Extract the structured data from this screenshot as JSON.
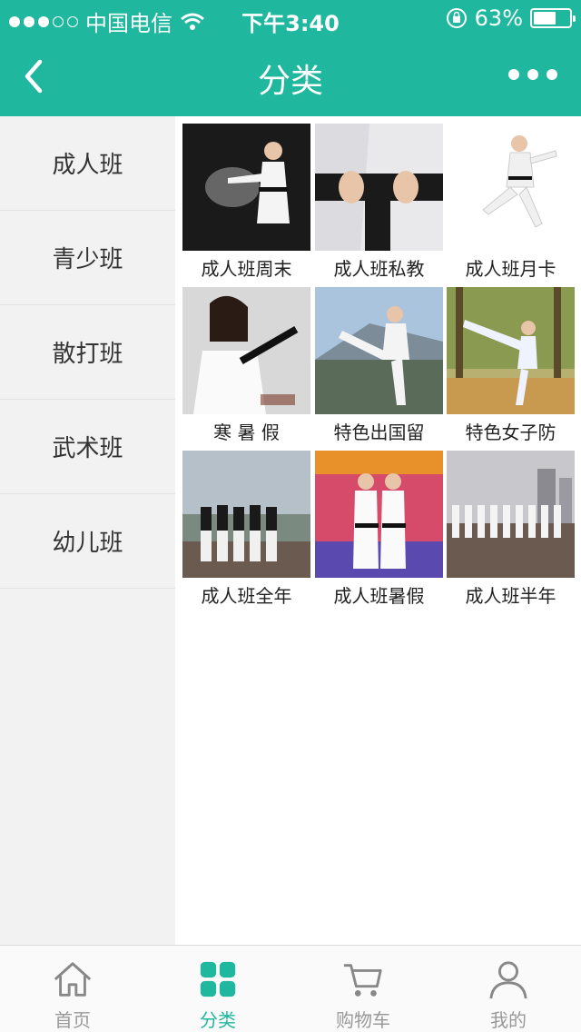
{
  "status": {
    "carrier": "中国电信",
    "time": "下午3:40",
    "battery": "63%",
    "battery_level": 0.63
  },
  "nav": {
    "title": "分类"
  },
  "colors": {
    "accent": "#1fb89f"
  },
  "sidebar": {
    "items": [
      {
        "label": "成人班"
      },
      {
        "label": "青少班"
      },
      {
        "label": "散打班"
      },
      {
        "label": "武术班"
      },
      {
        "label": "幼儿班"
      }
    ]
  },
  "products": [
    {
      "label": "成人班周末"
    },
    {
      "label": "成人班私教"
    },
    {
      "label": "成人班月卡"
    },
    {
      "label": "寒 暑 假"
    },
    {
      "label": "特色出国留"
    },
    {
      "label": "特色女子防"
    },
    {
      "label": "成人班全年"
    },
    {
      "label": "成人班暑假"
    },
    {
      "label": "成人班半年"
    }
  ],
  "tabs": [
    {
      "label": "首页",
      "icon": "home-icon"
    },
    {
      "label": "分类",
      "icon": "category-icon"
    },
    {
      "label": "购物车",
      "icon": "cart-icon"
    },
    {
      "label": "我的",
      "icon": "user-icon"
    }
  ]
}
